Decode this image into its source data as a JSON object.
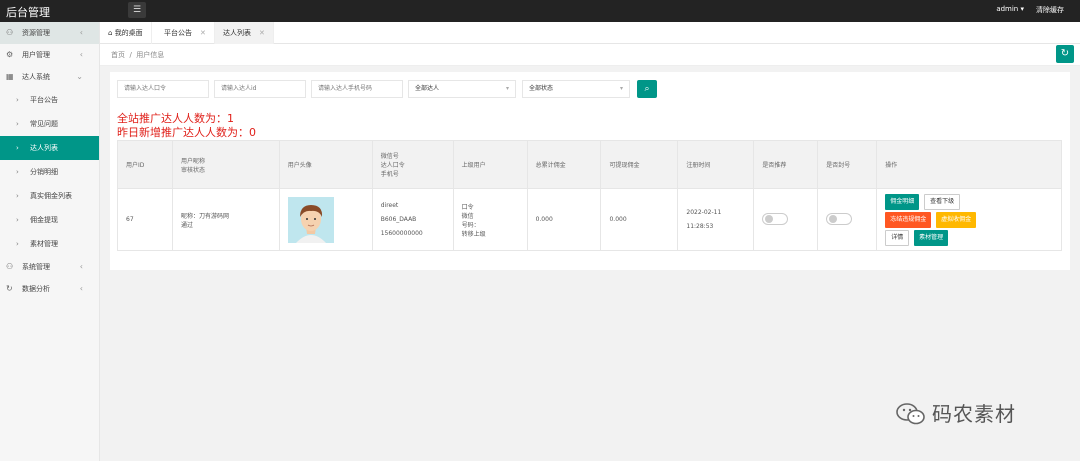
{
  "app": {
    "title": "后台管理",
    "user": "admin",
    "clear_cache": "清除缓存"
  },
  "sidebar": {
    "items": [
      {
        "label": "资源管理",
        "icon": "user-icon",
        "active": true
      },
      {
        "label": "用户管理",
        "icon": "gear-icon"
      },
      {
        "label": "达人系统",
        "icon": "grid-icon",
        "expanded": true
      }
    ],
    "subitems": [
      "平台公告",
      "常见问题",
      "达人列表",
      "分销明细",
      "真实佣金列表",
      "佣金提现",
      "素材管理"
    ],
    "items_after": [
      {
        "label": "系统管理",
        "icon": "user-icon"
      },
      {
        "label": "数据分析",
        "icon": "refresh-icon"
      }
    ]
  },
  "tabs": [
    {
      "label": "我的桌面",
      "icon": "home-icon"
    },
    {
      "label": "平台公告"
    },
    {
      "label": "达人列表",
      "active": true
    }
  ],
  "breadcrumb": {
    "home": "首页",
    "sep": "/",
    "current": "用户信息"
  },
  "filters": {
    "code_placeholder": "请输入达人口令",
    "id_placeholder": "请输入达人id",
    "phone_placeholder": "请输入达人手机号码",
    "type_select": "全部达人",
    "status_select": "全部状态"
  },
  "stats": {
    "line1": "全站推广达人人数为：1",
    "line2": "昨日新增推广达人人数为：0"
  },
  "table": {
    "headers": [
      {
        "l1": "用户ID"
      },
      {
        "l1": "用户昵称",
        "l2": "审核状态"
      },
      {
        "l1": "用户头像"
      },
      {
        "l1": "微信号",
        "l2": "达人口令",
        "l3": "手机号"
      },
      {
        "l1": "上级用户"
      },
      {
        "l1": "总累计佣金"
      },
      {
        "l1": "可提现佣金"
      },
      {
        "l1": "注册时间"
      },
      {
        "l1": "是否推荐"
      },
      {
        "l1": "是否封号"
      },
      {
        "l1": "操作"
      }
    ],
    "row": {
      "id": "67",
      "nickname": "昵称：刀有游码网",
      "status": "通过",
      "wechat": "direet",
      "code": "B606_DAAB",
      "phone": "15600000000",
      "sup_code": "口令",
      "sup_wechat": "微信",
      "sup_phone": "号码：",
      "sup_change": "转移上级",
      "total": "0.000",
      "withdrawable": "0.000",
      "reg_date": "2022-02-11",
      "reg_time": "11:28:53",
      "recommend": false,
      "banned": false,
      "actions": {
        "commission_detail": "佣金明细",
        "view_sub": "查看下级",
        "freeze_commission": "冻结违规佣金",
        "virtual_commission": "虚拟收佣金",
        "detail": "详情",
        "material": "素材管理"
      }
    }
  },
  "watermark": "码农素材",
  "colors": {
    "accent": "#009688",
    "topbar": "#232323",
    "stat_red": "#e0201a",
    "danger": "#ff5722",
    "warn": "#ffb800"
  }
}
